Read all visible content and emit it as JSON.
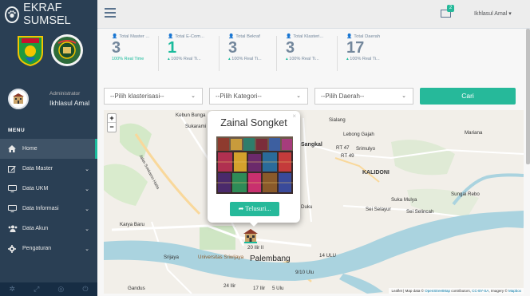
{
  "brand": {
    "title": "EKRAF SUMSEL"
  },
  "profile": {
    "role": "Administrator",
    "name": "Ikhlasul Amal"
  },
  "menu": {
    "title": "MENU",
    "items": [
      {
        "label": "Home",
        "icon": "home-icon",
        "active": true
      },
      {
        "label": "Data Master",
        "icon": "edit-icon"
      },
      {
        "label": "Data UKM",
        "icon": "desktop-icon"
      },
      {
        "label": "Data Informasi",
        "icon": "desktop-icon"
      },
      {
        "label": "Data Akun",
        "icon": "users-icon"
      },
      {
        "label": "Pengaturan",
        "icon": "gear-icon"
      }
    ]
  },
  "topnav": {
    "mail_count": "2",
    "user": "Ikhlasul Amal"
  },
  "tiles": [
    {
      "label": "Total Master ...",
      "count": "3",
      "sub_highlight": "",
      "sub": "100% Real Time",
      "green": false
    },
    {
      "label": "Total E-Com...",
      "count": "1",
      "sub_highlight": "",
      "sub": "100% Real Ti...",
      "green": true
    },
    {
      "label": "Total Bekraf",
      "count": "3",
      "sub_highlight": "",
      "sub": "100% Real Ti...",
      "green": false
    },
    {
      "label": "Total Klasteri...",
      "count": "3",
      "sub_highlight": "",
      "sub": "100% Real Ti...",
      "green": false
    },
    {
      "label": "Total Daerah",
      "count": "17",
      "sub_highlight": "",
      "sub": "100% Real Ti...",
      "green": false
    }
  ],
  "filters": {
    "klasterisasi": "--Pilih klasterisasi--",
    "kategori": "--Pilih Kategori--",
    "daerah": "--Pilih Daerah--",
    "search_button": "Cari"
  },
  "map": {
    "popup_title": "Zainal Songket",
    "popup_button": "Telusuri...",
    "places": {
      "kebun_bunga": "Kebun Bunga",
      "sukarami": "Sukarami",
      "sialang": "Sialang",
      "lebong_gajah": "Lebong Gajah",
      "mariana": "Mariana",
      "sangkal": "Sangkal",
      "rt47": "RT 47",
      "rt49": "RT 49",
      "srimulyo": "Srimulyo",
      "kalidoni": "KALIDONI",
      "suka_mulya": "Suka Mulya",
      "sungai_rebo": "Sungai Rebo",
      "sei_selayur": "Sei Selayur",
      "sei_selincah": "Sei Selincah",
      "duku": "Duku",
      "karya_baru": "Karya Baru",
      "srijaya": "Srijaya",
      "universitas": "Universitas Sriwijaya",
      "palembang": "Palembang",
      "ulu14": "14 ULU",
      "ulu9": "9/10 Ulu",
      "ilir20": "20 Ilir II",
      "ilir24": "24 Ilir",
      "ilir17": "17 Ilir",
      "ulu5": "5 Ulu",
      "gandus": "Gandus",
      "jalan": "Jalan Soekarno Hatta"
    },
    "attribution_prefix": "Leaflet | Map data ©",
    "attribution_osm": "OpenStreetMap",
    "attribution_mid": "contributors,",
    "attribution_cc": "CC-BY-SA",
    "attribution_suffix": ", Imagery ©",
    "attribution_mapbox": "Mapbox"
  },
  "colors": {
    "sidebar": "#2a3f54",
    "accent": "#26b99a",
    "river": "#aad3df"
  }
}
